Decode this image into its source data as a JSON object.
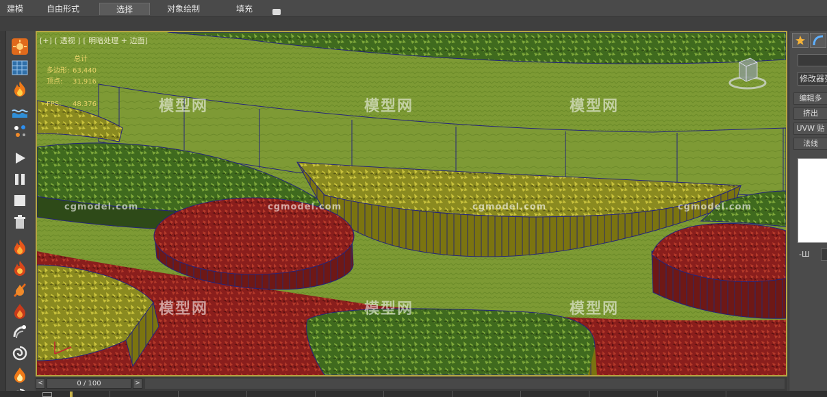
{
  "ribbon": {
    "tabs": [
      {
        "label": "建模",
        "active": false
      },
      {
        "label": "自由形式",
        "active": false
      },
      {
        "label": "选择",
        "active": true
      },
      {
        "label": "对象绘制",
        "active": false
      },
      {
        "label": "填充",
        "active": false
      }
    ]
  },
  "viewport": {
    "label": {
      "plus": "[+]",
      "view": "[ 透视 ]",
      "shading": "[ 明暗处理 + 边面]"
    },
    "stats": {
      "header": "总计",
      "polygons_label": "多边形:",
      "polygons": "63,440",
      "vertices_label": "顶点:",
      "vertices": "31,916",
      "fps_label": "FPS:",
      "fps": "48.376"
    },
    "watermarks": {
      "cn": "模型网",
      "en": "cgmodel.com"
    }
  },
  "right_panel": {
    "modifier_list": "修改器列表",
    "items": [
      "编辑多",
      "挤出",
      "UVW 贴",
      "法线"
    ],
    "pin_label": "-Ш"
  },
  "timeline": {
    "frame_display": "0 / 100",
    "prev": "<",
    "next": ">"
  },
  "colors": {
    "viewport_border": "#b7a642",
    "stats_text": "#e8d36a",
    "ui_background": "#444444"
  },
  "left_toolbar_icons": [
    "sun-icon",
    "grid-icon",
    "fire-icon",
    "water-icon",
    "particles-icon",
    "play-icon",
    "pause-icon",
    "stop-icon",
    "trash-icon",
    "flame-icon",
    "flame2-icon",
    "flame3-icon",
    "flame4-icon",
    "spray-icon",
    "vortex-icon",
    "flame5-icon",
    "vortex2-icon"
  ]
}
